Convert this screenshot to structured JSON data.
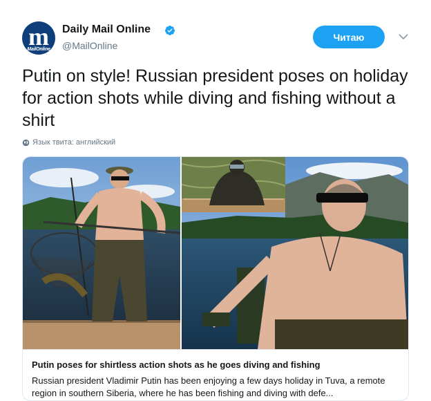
{
  "author": {
    "avatar_text": "m",
    "avatar_strip": "MailOnline",
    "name": "Daily Mail Online",
    "handle": "@MailOnline",
    "verified_icon": "verified-badge-icon"
  },
  "follow_button_label": "Читаю",
  "menu_icon": "chevron-down-icon",
  "tweet_text": "Putin on style! Russian president poses on holiday for action shots while diving and fishing without a shirt",
  "language_note": "Язык твита: английский",
  "card": {
    "title": "Putin poses for shirtless action shots as he goes diving and fishing",
    "description": "Russian president Vladimir Putin has been enjoying a few days holiday in Tuva, a remote region in southern Siberia, where he has been fishing and diving with defe..."
  },
  "colors": {
    "accent": "#1da1f2",
    "muted": "#657786",
    "avatar_bg": "#0f3f7a"
  }
}
